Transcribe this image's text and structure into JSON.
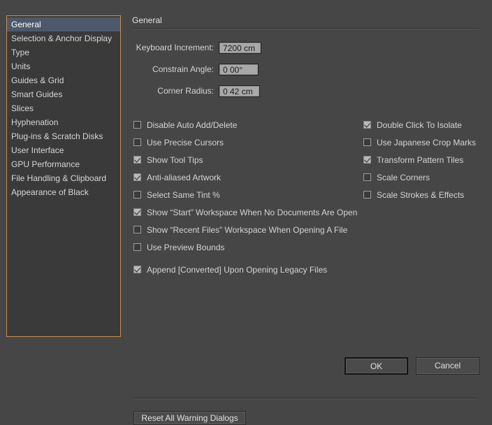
{
  "sidebar": {
    "items": [
      {
        "label": "General",
        "selected": true
      },
      {
        "label": "Selection & Anchor Display",
        "selected": false
      },
      {
        "label": "Type",
        "selected": false
      },
      {
        "label": "Units",
        "selected": false
      },
      {
        "label": "Guides & Grid",
        "selected": false
      },
      {
        "label": "Smart Guides",
        "selected": false
      },
      {
        "label": "Slices",
        "selected": false
      },
      {
        "label": "Hyphenation",
        "selected": false
      },
      {
        "label": "Plug-ins & Scratch Disks",
        "selected": false
      },
      {
        "label": "User Interface",
        "selected": false
      },
      {
        "label": "GPU Performance",
        "selected": false
      },
      {
        "label": "File Handling & Clipboard",
        "selected": false
      },
      {
        "label": "Appearance of Black",
        "selected": false
      }
    ]
  },
  "content": {
    "title": "General",
    "fields": [
      {
        "label": "Keyboard Increment:",
        "value": "7200 cm"
      },
      {
        "label": "Constrain Angle:",
        "value": "0 00°"
      },
      {
        "label": "Corner Radius:",
        "value": "0 42 cm"
      }
    ],
    "checkboxes_left": [
      {
        "label": "Disable Auto Add/Delete",
        "checked": false
      },
      {
        "label": "Use Precise Cursors",
        "checked": false
      },
      {
        "label": "Show Tool Tips",
        "checked": true
      },
      {
        "label": "Anti-aliased Artwork",
        "checked": true
      },
      {
        "label": "Select Same Tint %",
        "checked": false
      },
      {
        "label": "Show “Start” Workspace When No Documents Are Open",
        "checked": true
      },
      {
        "label": "Show “Recent Files” Workspace When Opening A File",
        "checked": false
      },
      {
        "label": "Use Preview Bounds",
        "checked": false
      },
      {
        "label": "Append [Converted] Upon Opening Legacy Files",
        "checked": true
      }
    ],
    "checkboxes_right": [
      {
        "label": "Double Click To Isolate",
        "checked": true
      },
      {
        "label": "Use Japanese Crop Marks",
        "checked": false
      },
      {
        "label": "Transform Pattern Tiles",
        "checked": true
      },
      {
        "label": "Scale Corners",
        "checked": false
      },
      {
        "label": "Scale Strokes & Effects",
        "checked": false
      }
    ],
    "reset_button": "Reset All Warning Dialogs"
  },
  "footer": {
    "ok": "OK",
    "cancel": "Cancel"
  },
  "colors": {
    "dialog_bg": "#464646",
    "sidebar_bg": "#3a3a3a",
    "sidebar_border": "#cc8e52",
    "selection_bg": "#4d596b",
    "input_bg": "#a8a8a8",
    "text": "#d4d4d4"
  }
}
